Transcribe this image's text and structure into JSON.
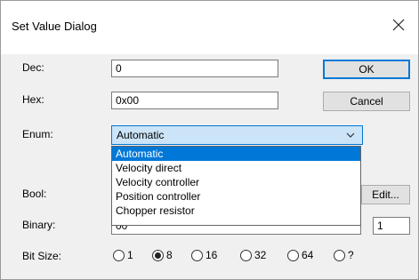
{
  "dialog": {
    "title": "Set Value Dialog"
  },
  "fields": {
    "dec": {
      "label": "Dec:",
      "value": "0"
    },
    "hex": {
      "label": "Hex:",
      "value": "0x00"
    },
    "enum": {
      "label": "Enum:",
      "value": "Automatic"
    },
    "bool": {
      "label": "Bool:"
    },
    "binary": {
      "label": "Binary:",
      "value": "00",
      "count": "1"
    },
    "bitsize": {
      "label": "Bit Size:"
    }
  },
  "buttons": {
    "ok": "OK",
    "cancel": "Cancel",
    "edit": "Edit..."
  },
  "enum_options": [
    {
      "label": "Automatic",
      "selected": true
    },
    {
      "label": "Velocity direct",
      "selected": false
    },
    {
      "label": "Velocity controller",
      "selected": false
    },
    {
      "label": "Position controller",
      "selected": false
    },
    {
      "label": "Chopper resistor",
      "selected": false
    }
  ],
  "bit_sizes": [
    {
      "label": "1",
      "checked": false
    },
    {
      "label": "8",
      "checked": true
    },
    {
      "label": "16",
      "checked": false
    },
    {
      "label": "32",
      "checked": false
    },
    {
      "label": "64",
      "checked": false
    },
    {
      "label": "?",
      "checked": false
    }
  ],
  "colors": {
    "accent": "#0078d7",
    "selection_bg": "#cce4f7",
    "window_bg": "#f0f0f0"
  },
  "icons": {
    "close": "close-icon",
    "dropdown": "chevron-down-icon"
  }
}
